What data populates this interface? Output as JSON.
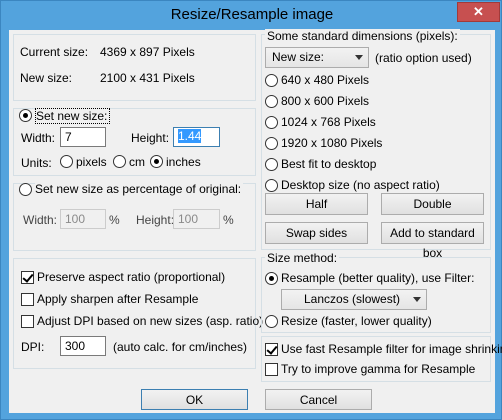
{
  "window": {
    "title": "Resize/Resample image",
    "close": "✕"
  },
  "info": {
    "current_label": "Current size:",
    "current_value": "4369  x  897  Pixels",
    "new_label": "New size:",
    "new_value": "2100  x  431  Pixels"
  },
  "set_size": {
    "radio_label": "Set new size:",
    "width_label": "Width:",
    "width_value": "7",
    "height_label": "Height:",
    "height_value": "1.44",
    "units_label": "Units:",
    "unit_pixels": "pixels",
    "unit_cm": "cm",
    "unit_inches": "inches"
  },
  "percent": {
    "radio_label": "Set new size as percentage of original:",
    "width_label": "Width:",
    "width_value": "100",
    "height_label": "Height:",
    "height_value": "100",
    "pct": "%"
  },
  "options": {
    "preserve": "Preserve aspect ratio (proportional)",
    "sharpen": "Apply sharpen after Resample",
    "adjust_dpi": "Adjust DPI based on new sizes (asp. ratio)",
    "dpi_label": "DPI:",
    "dpi_value": "300",
    "dpi_note": "(auto calc. for cm/inches)"
  },
  "standard": {
    "legend": "Some standard dimensions (pixels):",
    "select_value": "New size:",
    "select_note": "(ratio option used)",
    "items": [
      "640 x 480 Pixels",
      "800 x 600 Pixels",
      "1024 x 768 Pixels",
      "1920 x 1080 Pixels",
      "Best fit to desktop",
      "Desktop size (no aspect ratio)"
    ],
    "half": "Half",
    "double": "Double",
    "swap": "Swap sides",
    "add": "Add to standard box"
  },
  "method": {
    "legend": "Size method:",
    "resample": "Resample (better quality), use Filter:",
    "filter_value": "Lanczos (slowest)",
    "resize": "Resize (faster, lower quality)"
  },
  "extras": {
    "fast": "Use fast Resample filter for image shrinking",
    "gamma": "Try to improve gamma for Resample"
  },
  "buttons": {
    "ok": "OK",
    "cancel": "Cancel"
  }
}
